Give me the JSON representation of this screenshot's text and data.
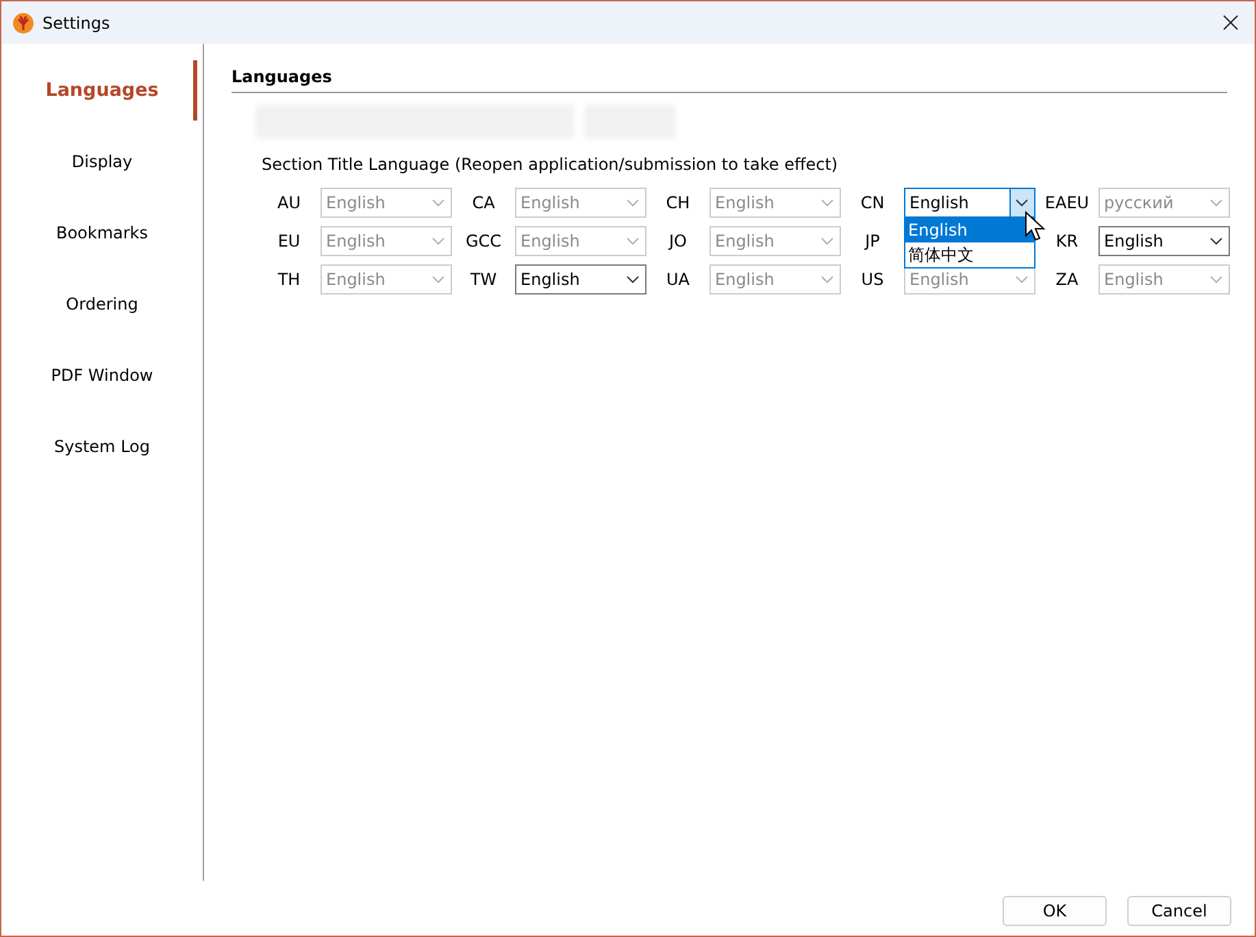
{
  "window": {
    "title": "Settings"
  },
  "sidebar": {
    "items": [
      {
        "label": "Languages",
        "selected": true
      },
      {
        "label": "Display",
        "selected": false
      },
      {
        "label": "Bookmarks",
        "selected": false
      },
      {
        "label": "Ordering",
        "selected": false
      },
      {
        "label": "PDF Window",
        "selected": false
      },
      {
        "label": "System Log",
        "selected": false
      }
    ]
  },
  "section": {
    "title": "Languages",
    "subtitle": "Section Title Language (Reopen application/submission to take effect)"
  },
  "regions": [
    {
      "code": "AU",
      "value": "English",
      "disabled": true
    },
    {
      "code": "CA",
      "value": "English",
      "disabled": true
    },
    {
      "code": "CH",
      "value": "English",
      "disabled": true
    },
    {
      "code": "CN",
      "value": "English",
      "disabled": false,
      "expanded": true,
      "options": [
        {
          "label": "English",
          "selected": true
        },
        {
          "label": "简体中文",
          "selected": false
        }
      ]
    },
    {
      "code": "EAEU",
      "value": "русский",
      "disabled": true
    },
    {
      "code": "EU",
      "value": "English",
      "disabled": true
    },
    {
      "code": "GCC",
      "value": "English",
      "disabled": true
    },
    {
      "code": "JO",
      "value": "English",
      "disabled": true
    },
    {
      "code": "JP"
    },
    {
      "code": "KR",
      "value": "English",
      "disabled": false
    },
    {
      "code": "TH",
      "value": "English",
      "disabled": true
    },
    {
      "code": "TW",
      "value": "English",
      "disabled": false
    },
    {
      "code": "UA",
      "value": "English",
      "disabled": true
    },
    {
      "code": "US",
      "value": "English",
      "disabled": true
    },
    {
      "code": "ZA",
      "value": "English",
      "disabled": true
    }
  ],
  "buttons": [
    "OK",
    "Cancel"
  ]
}
